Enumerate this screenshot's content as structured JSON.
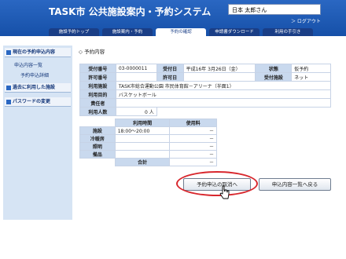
{
  "header": {
    "title": "TASK市 公共施設案内・予約システム",
    "user_name": "日本 太郎さん",
    "logout": "＞ ログアウト",
    "nav": [
      "施設予約トップ",
      "施設案内・予約",
      "予約の確認",
      "申請書ダウンロード",
      "利用の手引き"
    ],
    "active_nav": "予約の確認"
  },
  "sidebar": {
    "items": [
      {
        "label": "現在の予約申込内容",
        "sub": [
          "申込内容一覧",
          "予約申込詳細"
        ]
      },
      {
        "label": "過去に利用した施設"
      },
      {
        "label": "パスワードの変更"
      }
    ]
  },
  "main": {
    "section_title": "◇ 予約内容",
    "info": {
      "receipt_no_label": "受付番号",
      "receipt_no": "03-0000011",
      "receipt_date_label": "受付日",
      "receipt_date": "平成16年 3月26日（金）",
      "status_label": "状態",
      "status": "仮予約",
      "permit_no_label": "許可番号",
      "permit_no": "",
      "permit_date_label": "許可日",
      "permit_date": "",
      "method_label": "受付施設",
      "method": "ネット",
      "facility_label": "利用施設",
      "facility": "TASK市総合運動公園 市民体育館－アリーナ（半面1）",
      "purpose_label": "利用目的",
      "purpose": "バスケットボール",
      "person_label": "責任者",
      "person": "",
      "count_label": "利用人数",
      "count": "0 人"
    },
    "usage": {
      "col_time": "利用時間",
      "col_fee": "使用料",
      "rows": [
        {
          "label": "施設",
          "time": "18:00～20:00",
          "fee": "－"
        },
        {
          "label": "冷暖房",
          "time": "",
          "fee": "－"
        },
        {
          "label": "照明",
          "time": "",
          "fee": "－"
        },
        {
          "label": "備品",
          "time": "",
          "fee": "－"
        }
      ],
      "total_label": "合計",
      "total": "－"
    },
    "cancel_button": "予約申込の取消へ",
    "back_button": "申込内容一覧へ戻る"
  }
}
